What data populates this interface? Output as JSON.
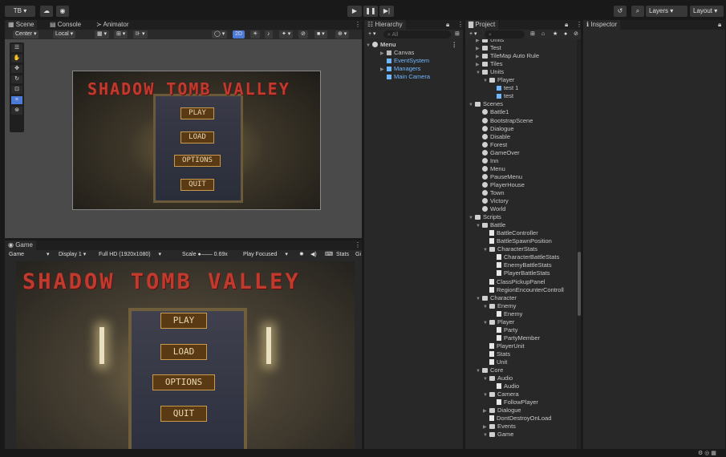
{
  "toolbar": {
    "account": "TB ▾",
    "history_icon": "history-icon",
    "search_icon": "search-icon",
    "layers": "Layers",
    "layout": "Layout"
  },
  "scene_tabs": {
    "scene": "Scene",
    "console": "Console",
    "animator": "Animator"
  },
  "scene_toolbar": {
    "pivot": "Center ▾",
    "space": "Local ▾",
    "mode2d": "2D"
  },
  "game_title_text": "SHADOW TOMB VALLEY",
  "menu_buttons": [
    "PLAY",
    "LOAD",
    "OPTIONS",
    "QUIT"
  ],
  "game_panel": {
    "tab": "Game",
    "display_mode": "Game",
    "display": "Display 1",
    "resolution": "Full HD (1920x1080)",
    "scale_label": "Scale",
    "scale_value": "0.69x",
    "play_mode": "Play Focused",
    "stats": "Stats",
    "gizmos": "Gi"
  },
  "hierarchy": {
    "tab": "Hierarchy",
    "search_placeholder": "All",
    "root": "Menu",
    "items": [
      "Canvas",
      "EventSystem",
      "Managers",
      "Main Camera"
    ]
  },
  "project": {
    "tab": "Project",
    "items": [
      {
        "label": "Units",
        "depth": 1,
        "kind": "folder",
        "open": false
      },
      {
        "label": "Test",
        "depth": 1,
        "kind": "folder",
        "open": false
      },
      {
        "label": "TileMap Auto Rule",
        "depth": 1,
        "kind": "folder",
        "open": false
      },
      {
        "label": "Tiles",
        "depth": 1,
        "kind": "folder",
        "open": false
      },
      {
        "label": "Units",
        "depth": 1,
        "kind": "folder",
        "open": true
      },
      {
        "label": "Player",
        "depth": 2,
        "kind": "folder",
        "open": true
      },
      {
        "label": "test 1",
        "depth": 3,
        "kind": "asset"
      },
      {
        "label": "test",
        "depth": 3,
        "kind": "asset"
      },
      {
        "label": "Scenes",
        "depth": 0,
        "kind": "folder",
        "open": true
      },
      {
        "label": "Battle1",
        "depth": 1,
        "kind": "scene"
      },
      {
        "label": "BootstrapScene",
        "depth": 1,
        "kind": "scene"
      },
      {
        "label": "Dialogue",
        "depth": 1,
        "kind": "scene"
      },
      {
        "label": "Disable",
        "depth": 1,
        "kind": "scene"
      },
      {
        "label": "Forest",
        "depth": 1,
        "kind": "scene"
      },
      {
        "label": "GameOver",
        "depth": 1,
        "kind": "scene"
      },
      {
        "label": "Inn",
        "depth": 1,
        "kind": "scene"
      },
      {
        "label": "Menu",
        "depth": 1,
        "kind": "scene"
      },
      {
        "label": "PauseMenu",
        "depth": 1,
        "kind": "scene"
      },
      {
        "label": "PlayerHouse",
        "depth": 1,
        "kind": "scene"
      },
      {
        "label": "Town",
        "depth": 1,
        "kind": "scene"
      },
      {
        "label": "Victory",
        "depth": 1,
        "kind": "scene"
      },
      {
        "label": "World",
        "depth": 1,
        "kind": "scene"
      },
      {
        "label": "Scripts",
        "depth": 0,
        "kind": "folder",
        "open": true
      },
      {
        "label": "Battle",
        "depth": 1,
        "kind": "folder",
        "open": true
      },
      {
        "label": "BattleController",
        "depth": 2,
        "kind": "script"
      },
      {
        "label": "BattleSpawnPosition",
        "depth": 2,
        "kind": "script"
      },
      {
        "label": "CharacterStats",
        "depth": 2,
        "kind": "folder",
        "open": true
      },
      {
        "label": "CharacterBattleStats",
        "depth": 3,
        "kind": "script"
      },
      {
        "label": "EnemyBattleStats",
        "depth": 3,
        "kind": "script"
      },
      {
        "label": "PlayerBattleStats",
        "depth": 3,
        "kind": "script"
      },
      {
        "label": "ClassPickupPanel",
        "depth": 2,
        "kind": "script"
      },
      {
        "label": "RegionEncounterControll",
        "depth": 2,
        "kind": "script"
      },
      {
        "label": "Character",
        "depth": 1,
        "kind": "folder",
        "open": true
      },
      {
        "label": "Enemy",
        "depth": 2,
        "kind": "folder",
        "open": true
      },
      {
        "label": "Enemy",
        "depth": 3,
        "kind": "script"
      },
      {
        "label": "Player",
        "depth": 2,
        "kind": "folder",
        "open": true
      },
      {
        "label": "Party",
        "depth": 3,
        "kind": "script"
      },
      {
        "label": "PartyMember",
        "depth": 3,
        "kind": "script"
      },
      {
        "label": "PlayerUnit",
        "depth": 2,
        "kind": "script"
      },
      {
        "label": "Stats",
        "depth": 2,
        "kind": "script"
      },
      {
        "label": "Unit",
        "depth": 2,
        "kind": "script"
      },
      {
        "label": "Core",
        "depth": 1,
        "kind": "folder",
        "open": true
      },
      {
        "label": "Audio",
        "depth": 2,
        "kind": "folder",
        "open": true
      },
      {
        "label": "Audio",
        "depth": 3,
        "kind": "script"
      },
      {
        "label": "Camera",
        "depth": 2,
        "kind": "folder",
        "open": true
      },
      {
        "label": "FollowPlayer",
        "depth": 3,
        "kind": "script"
      },
      {
        "label": "Dialogue",
        "depth": 2,
        "kind": "folder",
        "open": false
      },
      {
        "label": "DontDestroyOnLoad",
        "depth": 2,
        "kind": "script"
      },
      {
        "label": "Events",
        "depth": 2,
        "kind": "folder",
        "open": false
      },
      {
        "label": "Game",
        "depth": 2,
        "kind": "folder",
        "open": true
      }
    ]
  },
  "inspector": {
    "tab": "Inspector"
  },
  "colors": {
    "accent": "#4c7ad8",
    "title_red": "#c03a2e",
    "button_brown": "#5a3a14"
  }
}
